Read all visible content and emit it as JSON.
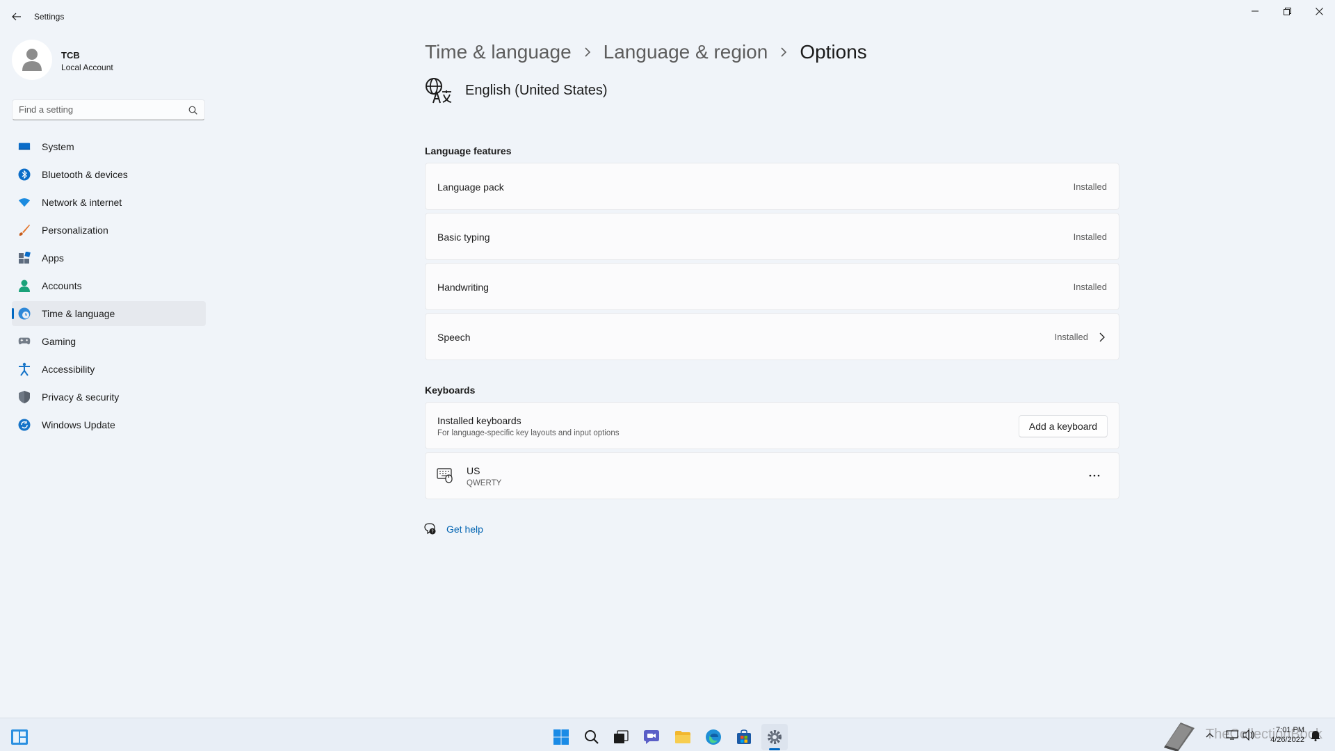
{
  "window": {
    "title": "Settings"
  },
  "profile": {
    "name": "TCB",
    "account_type": "Local Account"
  },
  "search": {
    "placeholder": "Find a setting"
  },
  "sidebar": {
    "items": [
      {
        "label": "System",
        "icon": "system-icon",
        "active": false
      },
      {
        "label": "Bluetooth & devices",
        "icon": "bluetooth-icon",
        "active": false
      },
      {
        "label": "Network & internet",
        "icon": "wifi-icon",
        "active": false
      },
      {
        "label": "Personalization",
        "icon": "brush-icon",
        "active": false
      },
      {
        "label": "Apps",
        "icon": "apps-icon",
        "active": false
      },
      {
        "label": "Accounts",
        "icon": "accounts-icon",
        "active": false
      },
      {
        "label": "Time & language",
        "icon": "globe-clock-icon",
        "active": true
      },
      {
        "label": "Gaming",
        "icon": "gamepad-icon",
        "active": false
      },
      {
        "label": "Accessibility",
        "icon": "accessibility-icon",
        "active": false
      },
      {
        "label": "Privacy & security",
        "icon": "shield-icon",
        "active": false
      },
      {
        "label": "Windows Update",
        "icon": "update-icon",
        "active": false
      }
    ]
  },
  "breadcrumb": {
    "items": [
      "Time & language",
      "Language & region"
    ],
    "current": "Options"
  },
  "language": {
    "name": "English (United States)"
  },
  "language_features": {
    "title": "Language features",
    "items": [
      {
        "label": "Language pack",
        "status": "Installed"
      },
      {
        "label": "Basic typing",
        "status": "Installed"
      },
      {
        "label": "Handwriting",
        "status": "Installed"
      },
      {
        "label": "Speech",
        "status": "Installed"
      }
    ]
  },
  "keyboards": {
    "title": "Keyboards",
    "installed_title": "Installed keyboards",
    "installed_desc": "For language-specific key layouts and input options",
    "add_button": "Add a keyboard",
    "list": [
      {
        "name": "US",
        "layout": "QWERTY"
      }
    ]
  },
  "help": {
    "label": "Get help"
  },
  "taskbar": {
    "time": "7:01 PM",
    "date": "4/26/2022",
    "watermark": "TheCollectionBook"
  },
  "colors": {
    "accent": "#0067c0",
    "link": "#0063b1",
    "background": "#f0f4f9"
  }
}
